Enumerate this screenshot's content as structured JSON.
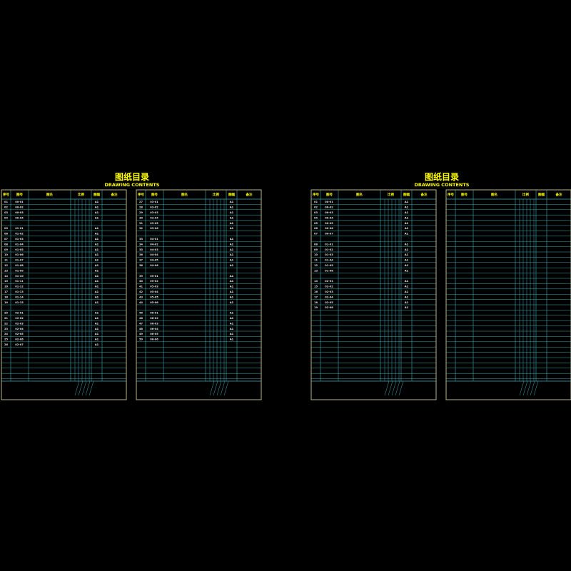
{
  "colors": {
    "background": "#000000",
    "frame": "#b8b48a",
    "grid": "#3fa9b4",
    "header_text": "#ffff00",
    "title": "#ffff00",
    "row_text": "#c8a070",
    "number_text": "#e6e6e6",
    "mark_text": "#ffffff"
  },
  "sets": [
    {
      "title": "图纸目录",
      "subtitle": "DRAWING CONTENTS",
      "sheets": [
        {
          "headers": [
            "序号",
            "图号",
            "图名",
            "比例",
            "图幅",
            "备注"
          ],
          "footer": "",
          "rows": [
            {
              "no": "01",
              "code": "00-01",
              "name": "",
              "size": "A1"
            },
            {
              "no": "02",
              "code": "00-02",
              "name": "",
              "size": "A1"
            },
            {
              "no": "03",
              "code": "00-03",
              "name": "",
              "size": "A1"
            },
            {
              "no": "04",
              "code": "00-04",
              "name": "",
              "size": "A1"
            },
            {
              "no": "",
              "code": "",
              "name": "",
              "size": ""
            },
            {
              "no": "05",
              "code": "01-01",
              "name": "",
              "size": "A1"
            },
            {
              "no": "06",
              "code": "01-02",
              "name": "",
              "size": "A1"
            },
            {
              "no": "07",
              "code": "01-03",
              "name": "",
              "size": "A1"
            },
            {
              "no": "08",
              "code": "01-04",
              "name": "",
              "size": "A1"
            },
            {
              "no": "09",
              "code": "01-05",
              "name": "",
              "size": "A1"
            },
            {
              "no": "10",
              "code": "01-06",
              "name": "",
              "size": "A1"
            },
            {
              "no": "11",
              "code": "01-07",
              "name": "",
              "size": "A1"
            },
            {
              "no": "12",
              "code": "01-08",
              "name": "",
              "size": "A1"
            },
            {
              "no": "13",
              "code": "01-09",
              "name": "",
              "size": "A1"
            },
            {
              "no": "14",
              "code": "01-10",
              "name": "",
              "size": "A1"
            },
            {
              "no": "15",
              "code": "01-11",
              "name": "",
              "size": "A1"
            },
            {
              "no": "16",
              "code": "01-12",
              "name": "",
              "size": "A1"
            },
            {
              "no": "17",
              "code": "01-13",
              "name": "",
              "size": "A1"
            },
            {
              "no": "18",
              "code": "01-14",
              "name": "",
              "size": "A1"
            },
            {
              "no": "19",
              "code": "01-15",
              "name": "",
              "size": "A1"
            },
            {
              "no": "",
              "code": "",
              "name": "",
              "size": ""
            },
            {
              "no": "20",
              "code": "02-01",
              "name": "",
              "size": "A1"
            },
            {
              "no": "21",
              "code": "02-02",
              "name": "",
              "size": "A1"
            },
            {
              "no": "22",
              "code": "02-03",
              "name": "",
              "size": "A1"
            },
            {
              "no": "23",
              "code": "02-04",
              "name": "",
              "size": "A1"
            },
            {
              "no": "24",
              "code": "02-05",
              "name": "",
              "size": "A1"
            },
            {
              "no": "25",
              "code": "02-06",
              "name": "",
              "size": "A1"
            },
            {
              "no": "26",
              "code": "02-07",
              "name": "",
              "size": "A1"
            }
          ]
        },
        {
          "headers": [
            "序号",
            "图号",
            "图名",
            "比例",
            "图幅",
            "备注"
          ],
          "footer": "",
          "rows": [
            {
              "no": "27",
              "code": "03-01",
              "name": "",
              "size": "A1"
            },
            {
              "no": "28",
              "code": "03-02",
              "name": "",
              "size": "A1"
            },
            {
              "no": "29",
              "code": "03-03",
              "name": "",
              "size": "A1"
            },
            {
              "no": "30",
              "code": "03-04",
              "name": "",
              "size": "A1"
            },
            {
              "no": "31",
              "code": "03-05",
              "name": "",
              "size": "A1"
            },
            {
              "no": "32",
              "code": "03-06",
              "name": "",
              "size": "A1"
            },
            {
              "no": "",
              "code": "",
              "name": "",
              "size": ""
            },
            {
              "no": "33",
              "code": "04-01",
              "name": "",
              "size": "A1"
            },
            {
              "no": "34",
              "code": "04-02",
              "name": "",
              "size": "A1"
            },
            {
              "no": "35",
              "code": "04-03",
              "name": "",
              "size": "A1"
            },
            {
              "no": "36",
              "code": "04-04",
              "name": "",
              "size": "A1"
            },
            {
              "no": "37",
              "code": "04-05",
              "name": "",
              "size": "A1"
            },
            {
              "no": "38",
              "code": "04-06",
              "name": "",
              "size": "A1"
            },
            {
              "no": "",
              "code": "",
              "name": "",
              "size": ""
            },
            {
              "no": "39",
              "code": "05-01",
              "name": "",
              "size": "A1"
            },
            {
              "no": "40",
              "code": "05-02",
              "name": "",
              "size": "A1"
            },
            {
              "no": "41",
              "code": "05-03",
              "name": "",
              "size": "A1"
            },
            {
              "no": "42",
              "code": "05-04",
              "name": "",
              "size": "A1"
            },
            {
              "no": "43",
              "code": "05-05",
              "name": "",
              "size": "A1"
            },
            {
              "no": "44",
              "code": "05-06",
              "name": "",
              "size": "A1"
            },
            {
              "no": "",
              "code": "",
              "name": "",
              "size": ""
            },
            {
              "no": "45",
              "code": "06-01",
              "name": "",
              "size": "A1"
            },
            {
              "no": "46",
              "code": "06-02",
              "name": "",
              "size": "A1"
            },
            {
              "no": "47",
              "code": "06-03",
              "name": "",
              "size": "A1"
            },
            {
              "no": "48",
              "code": "06-04",
              "name": "",
              "size": "A1"
            },
            {
              "no": "49",
              "code": "06-05",
              "name": "",
              "size": "A1"
            },
            {
              "no": "50",
              "code": "06-06",
              "name": "",
              "size": "A1"
            }
          ]
        }
      ]
    },
    {
      "title": "图纸目录",
      "subtitle": "DRAWING CONTENTS",
      "sheets": [
        {
          "headers": [
            "序号",
            "图号",
            "图名",
            "比例",
            "图幅",
            "备注"
          ],
          "footer": "",
          "rows": [
            {
              "no": "01",
              "code": "00-01",
              "name": "",
              "size": "A1"
            },
            {
              "no": "02",
              "code": "00-02",
              "name": "",
              "size": "A1"
            },
            {
              "no": "03",
              "code": "00-03",
              "name": "",
              "size": "A1"
            },
            {
              "no": "04",
              "code": "00-04",
              "name": "",
              "size": "A1"
            },
            {
              "no": "05",
              "code": "00-05",
              "name": "",
              "size": "A1"
            },
            {
              "no": "06",
              "code": "00-06",
              "name": "",
              "size": "A1"
            },
            {
              "no": "07",
              "code": "00-07",
              "name": "",
              "size": "A1"
            },
            {
              "no": "",
              "code": "",
              "name": "",
              "size": ""
            },
            {
              "no": "08",
              "code": "01-01",
              "name": "",
              "size": "A1"
            },
            {
              "no": "09",
              "code": "01-02",
              "name": "",
              "size": "A1"
            },
            {
              "no": "10",
              "code": "01-03",
              "name": "",
              "size": "A1"
            },
            {
              "no": "11",
              "code": "01-04",
              "name": "",
              "size": "A1"
            },
            {
              "no": "12",
              "code": "01-05",
              "name": "",
              "size": "A1"
            },
            {
              "no": "13",
              "code": "01-06",
              "name": "",
              "size": "A1"
            },
            {
              "no": "",
              "code": "",
              "name": "",
              "size": ""
            },
            {
              "no": "14",
              "code": "02-01",
              "name": "",
              "size": "A1"
            },
            {
              "no": "15",
              "code": "02-02",
              "name": "",
              "size": "A1"
            },
            {
              "no": "16",
              "code": "02-03",
              "name": "",
              "size": "A1"
            },
            {
              "no": "17",
              "code": "02-04",
              "name": "",
              "size": "A1"
            },
            {
              "no": "18",
              "code": "02-05",
              "name": "",
              "size": "A1"
            },
            {
              "no": "19",
              "code": "02-06",
              "name": "",
              "size": "A1"
            }
          ]
        },
        {
          "headers": [
            "序号",
            "图号",
            "图名",
            "比例",
            "图幅",
            "备注"
          ],
          "footer": "",
          "rows": []
        }
      ]
    }
  ]
}
